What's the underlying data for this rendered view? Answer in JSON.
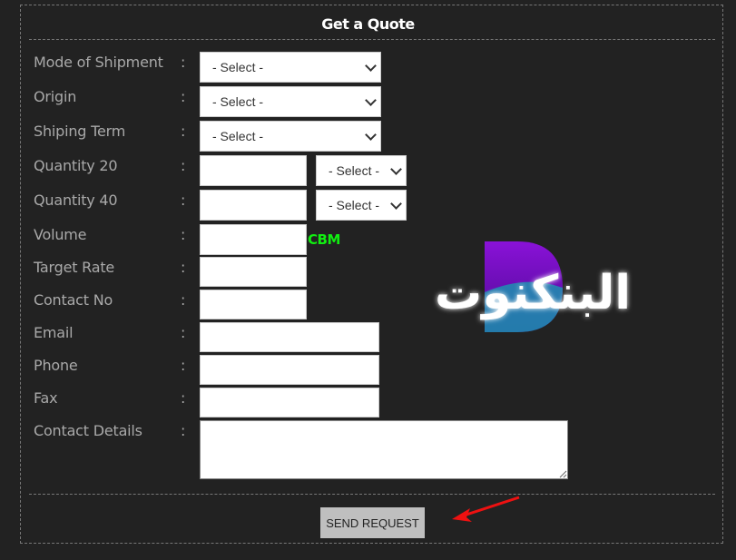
{
  "form": {
    "title": "Get a Quote",
    "colon": ":",
    "fields": [
      {
        "label": "Mode of Shipment",
        "value": "- Select -"
      },
      {
        "label": "Origin",
        "value": "- Select -"
      },
      {
        "label": "Shiping Term",
        "value": "- Select -"
      },
      {
        "label": "Quantity 20",
        "value": "",
        "unit_select": "- Select -"
      },
      {
        "label": "Quantity 40",
        "value": "",
        "unit_select": "- Select -"
      },
      {
        "label": "Volume",
        "value": "",
        "unit": "CBM"
      },
      {
        "label": "Target Rate",
        "value": ""
      },
      {
        "label": "Contact No",
        "value": ""
      },
      {
        "label": "Email",
        "value": ""
      },
      {
        "label": "Phone",
        "value": ""
      },
      {
        "label": "Fax",
        "value": ""
      },
      {
        "label": "Contact Details",
        "value": ""
      }
    ],
    "submit_label": "SEND REQUEST"
  },
  "watermark": {
    "text": "البنكنوت"
  },
  "colors": {
    "background": "#222222",
    "unit": "#11ee11",
    "arrow": "#ee1111",
    "button": "#bfbfbf"
  }
}
